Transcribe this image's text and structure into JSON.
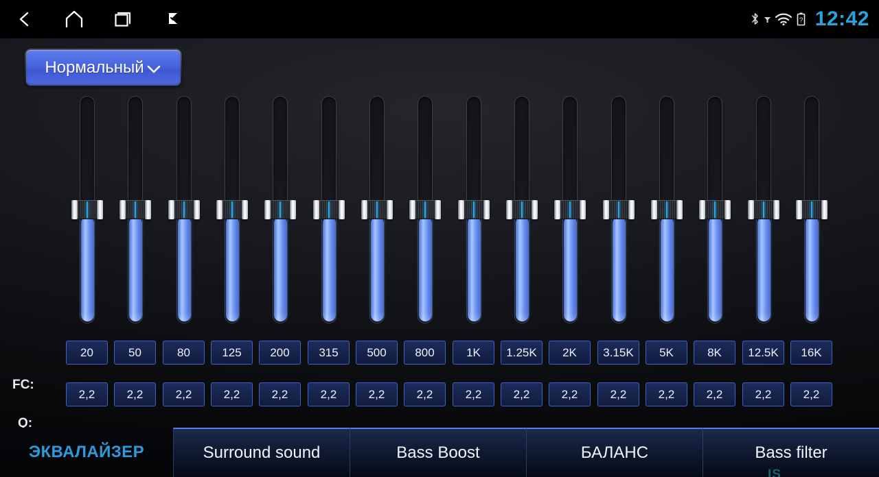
{
  "statusbar": {
    "nav": [
      {
        "name": "back-icon",
        "label": "Back"
      },
      {
        "name": "home-icon",
        "label": "Home"
      },
      {
        "name": "recents-icon",
        "label": "Recent apps"
      },
      {
        "name": "flag-check-icon",
        "label": "Tasks"
      }
    ],
    "icons": [
      "bluetooth-icon",
      "signal-icon",
      "wifi-icon",
      "battery-unknown-icon"
    ],
    "clock": "12:42",
    "clock_color": "#27a3dd"
  },
  "preset": {
    "label": "Нормальный",
    "chevron": "chevron-down-icon"
  },
  "equalizer": {
    "fc_label": "FC:",
    "q_label": "Q:",
    "bands": [
      {
        "fc": "20",
        "q": "2,2",
        "level": 50
      },
      {
        "fc": "50",
        "q": "2,2",
        "level": 50
      },
      {
        "fc": "80",
        "q": "2,2",
        "level": 50
      },
      {
        "fc": "125",
        "q": "2,2",
        "level": 50
      },
      {
        "fc": "200",
        "q": "2,2",
        "level": 50
      },
      {
        "fc": "315",
        "q": "2,2",
        "level": 50
      },
      {
        "fc": "500",
        "q": "2,2",
        "level": 50
      },
      {
        "fc": "800",
        "q": "2,2",
        "level": 50
      },
      {
        "fc": "1K",
        "q": "2,2",
        "level": 50
      },
      {
        "fc": "1.25K",
        "q": "2,2",
        "level": 50
      },
      {
        "fc": "2K",
        "q": "2,2",
        "level": 50
      },
      {
        "fc": "3.15K",
        "q": "2,2",
        "level": 50
      },
      {
        "fc": "5K",
        "q": "2,2",
        "level": 50
      },
      {
        "fc": "8K",
        "q": "2,2",
        "level": 50
      },
      {
        "fc": "12.5K",
        "q": "2,2",
        "level": 50
      },
      {
        "fc": "16K",
        "q": "2,2",
        "level": 50
      }
    ]
  },
  "tabs": [
    {
      "label": "ЭКВАЛАЙЗЕР",
      "active": true
    },
    {
      "label": "Surround sound",
      "active": false
    },
    {
      "label": "Bass Boost",
      "active": false
    },
    {
      "label": "БАЛАНС",
      "active": false
    },
    {
      "label": "Bass filter",
      "active": false
    }
  ],
  "watermark": {
    "text": "IS"
  },
  "colors": {
    "accent_blue": "#2a9bdc",
    "slider_blue": "#85a9f6",
    "box_border": "#3e62c9",
    "box_fill": "#16234b",
    "preset_blue": "#4a66e0"
  }
}
